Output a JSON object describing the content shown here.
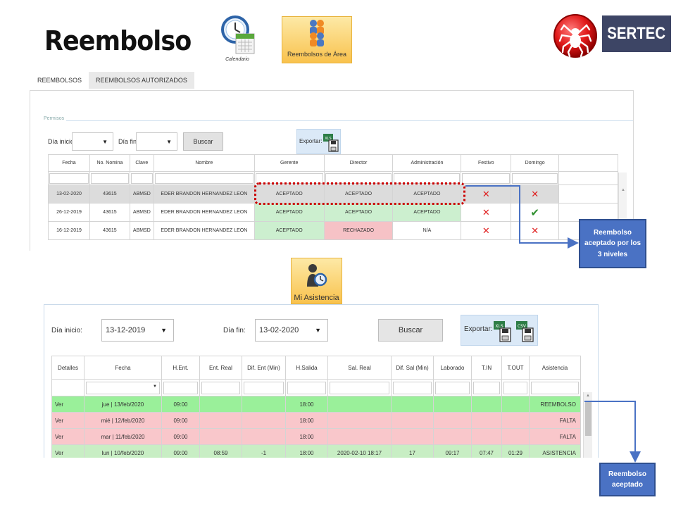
{
  "header": {
    "title": "Reembolso",
    "calendar_label": "Calendario",
    "area_button_label": "Reembolsos de Área",
    "brand": "SERTEC"
  },
  "tabs": [
    "REEMBOLSOS",
    "REEMBOLSOS AUTORIZADOS"
  ],
  "screen1": {
    "fieldset_legend": "Permisos",
    "dia_inicio_label": "Día inicio:",
    "dia_fin_label": "Día fin:",
    "buscar_label": "Buscar",
    "exportar_label": "Exportar:",
    "columns": [
      "Fecha",
      "No. Nomina",
      "Clave",
      "Nombre",
      "Gerente",
      "Director",
      "Administración",
      "Festivo",
      "Domingo"
    ],
    "rows": [
      {
        "fecha": "13-02-2020",
        "nomina": "43615",
        "clave": "ABMSD",
        "nombre": "EDER BRANDON HERNANDEZ LEON",
        "gerente": "ACEPTADO",
        "director": "ACEPTADO",
        "admin": "ACEPTADO",
        "festivo": "✕",
        "domingo": "✕"
      },
      {
        "fecha": "26-12-2019",
        "nomina": "43615",
        "clave": "ABMSD",
        "nombre": "EDER BRANDON HERNANDEZ LEON",
        "gerente": "ACEPTADO",
        "director": "ACEPTADO",
        "admin": "ACEPTADO",
        "festivo": "✕",
        "domingo": "✔"
      },
      {
        "fecha": "16-12-2019",
        "nomina": "43615",
        "clave": "ABMSD",
        "nombre": "EDER BRANDON HERNANDEZ LEON",
        "gerente": "ACEPTADO",
        "director": "RECHAZADO",
        "admin": "N/A",
        "festivo": "✕",
        "domingo": "✕"
      }
    ],
    "callout": [
      "Reembolso",
      "aceptado por los",
      "3 niveles"
    ]
  },
  "screen2": {
    "button_label": "Mi Asistencia",
    "dia_inicio_label": "Día inicio:",
    "dia_inicio_value": "13-12-2019",
    "dia_fin_label": "Día fin:",
    "dia_fin_value": "13-02-2020",
    "buscar_label": "Buscar",
    "exportar_label": "Exportar:",
    "columns": [
      "Detalles",
      "Fecha",
      "H.Ent.",
      "Ent. Real",
      "Dif. Ent (Min)",
      "H.Salida",
      "Sal. Real",
      "Dif. Sal (Min)",
      "Laborado",
      "T.IN",
      "T.OUT",
      "Asistencia"
    ],
    "rows": [
      {
        "ver": "Ver",
        "fecha": "jue | 13/feb/2020",
        "hent": "09:00",
        "entreal": "",
        "difent": "",
        "hsal": "18:00",
        "salreal": "",
        "difsal": "",
        "laborado": "",
        "tin": "",
        "tout": "",
        "asistencia": "REEMBOLSO"
      },
      {
        "ver": "Ver",
        "fecha": "mié | 12/feb/2020",
        "hent": "09:00",
        "entreal": "",
        "difent": "",
        "hsal": "18:00",
        "salreal": "",
        "difsal": "",
        "laborado": "",
        "tin": "",
        "tout": "",
        "asistencia": "FALTA"
      },
      {
        "ver": "Ver",
        "fecha": "mar | 11/feb/2020",
        "hent": "09:00",
        "entreal": "",
        "difent": "",
        "hsal": "18:00",
        "salreal": "",
        "difsal": "",
        "laborado": "",
        "tin": "",
        "tout": "",
        "asistencia": "FALTA"
      },
      {
        "ver": "Ver",
        "fecha": "lun | 10/feb/2020",
        "hent": "09:00",
        "entreal": "08:59",
        "difent": "-1",
        "hsal": "18:00",
        "salreal": "2020-02-10 18:17",
        "difsal": "17",
        "laborado": "09:17",
        "tin": "07:47",
        "tout": "01:29",
        "asistencia": "ASISTENCIA"
      }
    ],
    "callout": [
      "Reembolso",
      "aceptado"
    ]
  },
  "colors": {
    "accepted": "#ccefcf",
    "rejected": "#f6c2c6",
    "row_reembolso": "#9af09a",
    "row_falta": "#f9c7cb",
    "row_asistencia": "#c8eec4",
    "callout": "#4a72c4",
    "highlight": "#cc0000"
  }
}
